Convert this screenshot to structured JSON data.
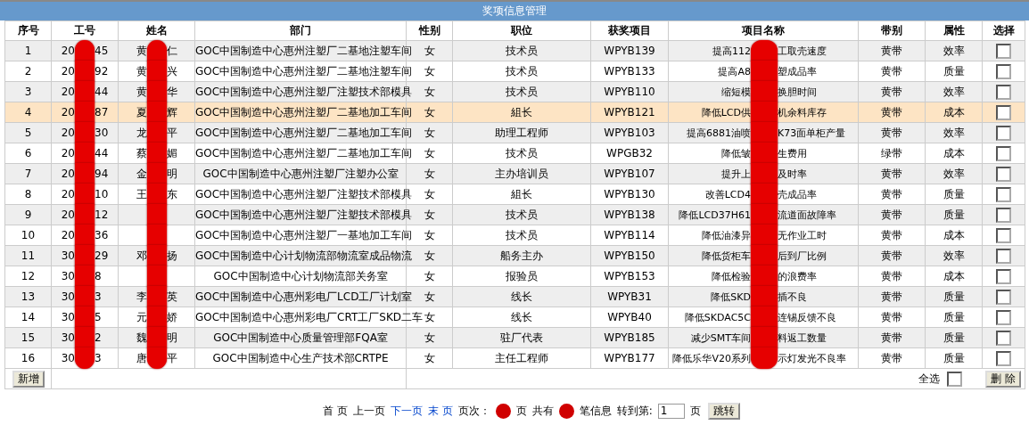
{
  "title": "奖项信息管理",
  "columns": [
    "序号",
    "工号",
    "姓名",
    "部门",
    "性别",
    "职位",
    "获奖项目",
    "项目名称",
    "带别",
    "属性",
    "选择"
  ],
  "rows": [
    {
      "no": "1",
      "id": [
        "20",
        "45"
      ],
      "name": [
        "黄",
        "仁"
      ],
      "dept": "GOC中国制造中心惠州注塑厂二基地注塑车间",
      "gender": "女",
      "position": "技术员",
      "award": "WPYB139",
      "project": [
        "提高112",
        "工取壳速度"
      ],
      "belt": "黄带",
      "attribute": "效率",
      "checked": false,
      "selected": false
    },
    {
      "no": "2",
      "id": [
        "20",
        "92"
      ],
      "name": [
        "黄",
        "兴"
      ],
      "dept": "GOC中国制造中心惠州注塑厂二基地注塑车间",
      "gender": "女",
      "position": "技术员",
      "award": "WPYB133",
      "project": [
        "提高A8",
        "塑成品率"
      ],
      "belt": "黄带",
      "attribute": "质量",
      "checked": false,
      "selected": false
    },
    {
      "no": "3",
      "id": [
        "20",
        "44"
      ],
      "name": [
        "黄",
        "华"
      ],
      "dept": "GOC中国制造中心惠州注塑厂注塑技术部模具",
      "gender": "女",
      "position": "技术员",
      "award": "WPYB110",
      "project": [
        "缩短模",
        "换胆时间"
      ],
      "belt": "黄带",
      "attribute": "效率",
      "checked": false,
      "selected": false
    },
    {
      "no": "4",
      "id": [
        "20",
        "87"
      ],
      "name": [
        "夏",
        "辉"
      ],
      "dept": "GOC中国制造中心惠州注塑厂二基地加工车间",
      "gender": "女",
      "position": "組长",
      "award": "WPYB121",
      "project": [
        "降低LCD供",
        "机余料库存"
      ],
      "belt": "黄带",
      "attribute": "成本",
      "checked": false,
      "selected": true
    },
    {
      "no": "5",
      "id": [
        "20",
        "30"
      ],
      "name": [
        "龙",
        "平"
      ],
      "dept": "GOC中国制造中心惠州注塑厂二基地加工车间",
      "gender": "女",
      "position": "助理工程师",
      "award": "WPYB103",
      "project": [
        "提高6881油喷",
        "K73面单柜产量"
      ],
      "belt": "黄带",
      "attribute": "效率",
      "checked": false,
      "selected": false
    },
    {
      "no": "6",
      "id": [
        "20",
        "44"
      ],
      "name": [
        "蔡",
        "媚"
      ],
      "dept": "GOC中国制造中心惠州注塑厂二基地加工车间",
      "gender": "女",
      "position": "技术员",
      "award": "WPGB32",
      "project": [
        "降低皱",
        "生费用"
      ],
      "belt": "绿带",
      "attribute": "成本",
      "checked": false,
      "selected": false
    },
    {
      "no": "7",
      "id": [
        "20",
        "94"
      ],
      "name": [
        "金",
        "明"
      ],
      "dept": "GOC中国制造中心惠州注塑厂注塑办公室",
      "gender": "女",
      "position": "主办培训员",
      "award": "WPYB107",
      "project": [
        "提升上",
        "及时率"
      ],
      "belt": "黄带",
      "attribute": "效率",
      "checked": false,
      "selected": false
    },
    {
      "no": "8",
      "id": [
        "20",
        "10"
      ],
      "name": [
        "王",
        "东"
      ],
      "dept": "GOC中国制造中心惠州注塑厂注塑技术部模具",
      "gender": "女",
      "position": "組长",
      "award": "WPYB130",
      "project": [
        "改善LCD4",
        "壳成品率"
      ],
      "belt": "黄带",
      "attribute": "质量",
      "checked": false,
      "selected": false
    },
    {
      "no": "9",
      "id": [
        "20",
        "12"
      ],
      "dept": "GOC中国制造中心惠州注塑厂注塑技术部模具",
      "gender": "女",
      "position": "技术员",
      "award": "WPYB138",
      "project": [
        "降低LCD37H61",
        "流道面故障率"
      ],
      "belt": "黄带",
      "attribute": "质量",
      "checked": false,
      "selected": false
    },
    {
      "no": "10",
      "id": [
        "20",
        "36"
      ],
      "dept": "GOC中国制造中心惠州注塑厂一基地加工车间",
      "gender": "女",
      "position": "技术员",
      "award": "WPYB114",
      "project": [
        "降低油漆异",
        "无作业工时"
      ],
      "belt": "黄带",
      "attribute": "成本",
      "checked": false,
      "selected": false
    },
    {
      "no": "11",
      "id": [
        "30",
        "29"
      ],
      "name": [
        "邓",
        "扬"
      ],
      "dept": "GOC中国制造中心计划物流部物流室成品物流",
      "gender": "女",
      "position": "船务主办",
      "award": "WPYB150",
      "project": [
        "降低货柜车",
        "后到厂比例"
      ],
      "belt": "黄带",
      "attribute": "效率",
      "checked": false,
      "selected": false
    },
    {
      "no": "12",
      "id": [
        "30",
        "8"
      ],
      "dept": "GOC中国制造中心计划物流部关务室",
      "gender": "女",
      "position": "报验员",
      "award": "WPYB153",
      "project": [
        "降低检验",
        "的浪费率"
      ],
      "belt": "黄带",
      "attribute": "成本",
      "checked": false,
      "selected": false
    },
    {
      "no": "13",
      "id": [
        "30",
        "3"
      ],
      "name": [
        "李",
        "英"
      ],
      "dept": "GOC中国制造中心惠州彩电厂LCD工厂计划室",
      "gender": "女",
      "position": "线长",
      "award": "WPYB31",
      "project": [
        "降低SKD",
        "插不良"
      ],
      "belt": "黄带",
      "attribute": "质量",
      "checked": false,
      "selected": false
    },
    {
      "no": "14",
      "id": [
        "30",
        "5"
      ],
      "name": [
        "元",
        "娇"
      ],
      "dept": "GOC中国制造中心惠州彩电厂CRT工厂SKD二车",
      "gender": "女",
      "position": "线长",
      "award": "WPYB40",
      "project": [
        "降低SKDAC5C",
        "连锡反馈不良"
      ],
      "belt": "黄带",
      "attribute": "质量",
      "checked": false,
      "selected": false
    },
    {
      "no": "15",
      "id": [
        "30",
        "2"
      ],
      "name": [
        "魏",
        "明"
      ],
      "dept": "GOC中国制造中心质量管理部FQA室",
      "gender": "女",
      "position": "驻厂代表",
      "award": "WPYB185",
      "project": [
        "减少SMT车间",
        "料返工数量"
      ],
      "belt": "黄带",
      "attribute": "质量",
      "checked": false,
      "selected": false
    },
    {
      "no": "16",
      "id": [
        "30",
        "3"
      ],
      "name": [
        "唐",
        "平"
      ],
      "dept": "GOC中国制造中心生产技术部CRTPE",
      "gender": "女",
      "position": "主任工程师",
      "award": "WPYB177",
      "project": [
        "降低乐华V20系列",
        "示灯发光不良率"
      ],
      "belt": "黄带",
      "attribute": "质量",
      "checked": false,
      "selected": false
    }
  ],
  "add_button": "新增",
  "select_all": {
    "label": "全选",
    "checked": false
  },
  "delete_button": "删 除",
  "pager": [
    {
      "kind": "text",
      "text": "首 页"
    },
    {
      "kind": "text",
      "text": "上一页"
    },
    {
      "kind": "link",
      "text": "下一页"
    },
    {
      "kind": "link",
      "text": "末 页"
    },
    {
      "kind": "text",
      "text": "页次："
    },
    {
      "kind": "redacted"
    },
    {
      "kind": "text",
      "text": "页"
    },
    {
      "kind": "text",
      "text": "共有"
    },
    {
      "kind": "redacted"
    },
    {
      "kind": "text",
      "text": "笔信息"
    },
    {
      "kind": "text",
      "text": "转到第:"
    },
    {
      "kind": "input",
      "value": "1"
    },
    {
      "kind": "text",
      "text": "页"
    },
    {
      "kind": "button",
      "text": "跳转"
    }
  ]
}
